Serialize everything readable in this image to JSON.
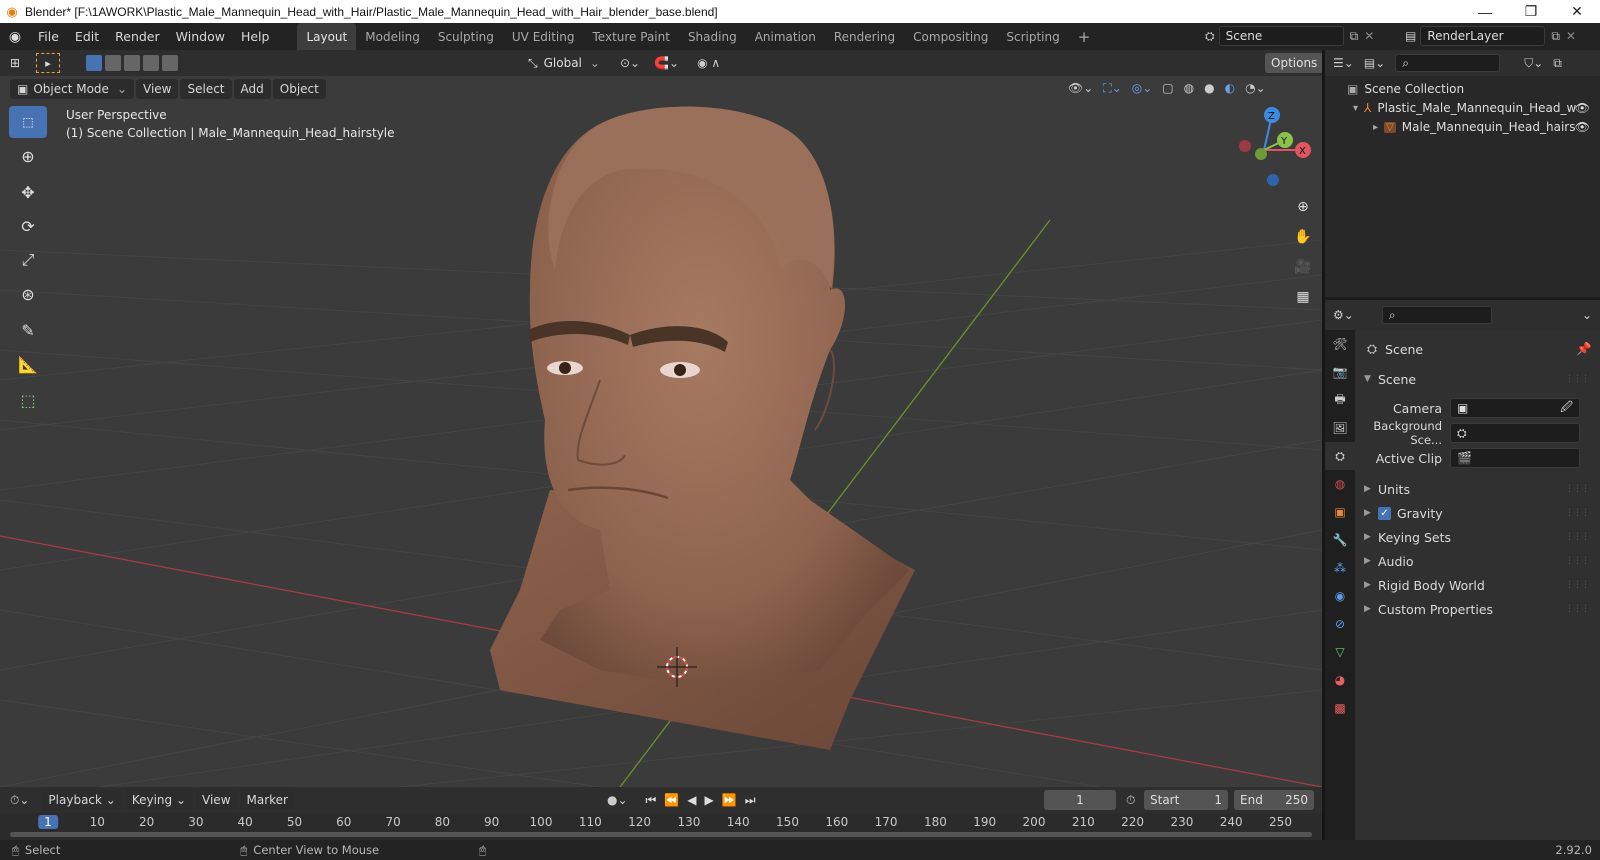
{
  "window": {
    "title": "Blender* [F:\\1AWORK\\Plastic_Male_Mannequin_Head_with_Hair/Plastic_Male_Mannequin_Head_with_Hair_blender_base.blend]",
    "minimize": "—",
    "maximize": "❐",
    "close": "✕"
  },
  "menu": [
    "File",
    "Edit",
    "Render",
    "Window",
    "Help"
  ],
  "workspaces": [
    "Layout",
    "Modeling",
    "Sculpting",
    "UV Editing",
    "Texture Paint",
    "Shading",
    "Animation",
    "Rendering",
    "Compositing",
    "Scripting"
  ],
  "active_workspace": "Layout",
  "scene_field": "Scene",
  "view_layer_field": "RenderLayer",
  "viewport": {
    "mode": "Object Mode",
    "menus": [
      "View",
      "Select",
      "Add",
      "Object"
    ],
    "orientation": "Global",
    "options": "Options",
    "overlay_line1": "User Perspective",
    "overlay_line2": "(1) Scene Collection | Male_Mannequin_Head_hairstyle",
    "gizmo": {
      "x": "X",
      "y": "Y",
      "z": "Z"
    }
  },
  "outliner": {
    "root": "Scene Collection",
    "items": [
      {
        "label": "Plastic_Male_Mannequin_Head_w",
        "expanded": "▾"
      },
      {
        "label": "Male_Mannequin_Head_hairs",
        "expanded": "▸"
      }
    ]
  },
  "properties": {
    "context": "Scene",
    "panel": "Scene",
    "camera_label": "Camera",
    "background_label": "Background Sce...",
    "active_clip_label": "Active Clip",
    "sections": [
      "Units",
      "Gravity",
      "Keying Sets",
      "Audio",
      "Rigid Body World",
      "Custom Properties"
    ],
    "gravity_checked": true
  },
  "timeline": {
    "menus": [
      "Playback",
      "Keying",
      "View",
      "Marker"
    ],
    "current_frame": "1",
    "start_label": "Start",
    "start": "1",
    "end_label": "End",
    "end": "250",
    "ticks": [
      "1",
      "10",
      "20",
      "30",
      "40",
      "50",
      "60",
      "70",
      "80",
      "90",
      "100",
      "110",
      "120",
      "130",
      "140",
      "150",
      "160",
      "170",
      "180",
      "190",
      "200",
      "210",
      "220",
      "230",
      "240",
      "250"
    ]
  },
  "status": {
    "left": "Select",
    "middle": "Center View to Mouse",
    "version": "2.92.0"
  },
  "colors": {
    "accent": "#4772b3",
    "x_axis": "#e05560",
    "y_axis": "#8bc34a",
    "z_axis": "#3d8be0",
    "skin": "#9a6c56"
  }
}
